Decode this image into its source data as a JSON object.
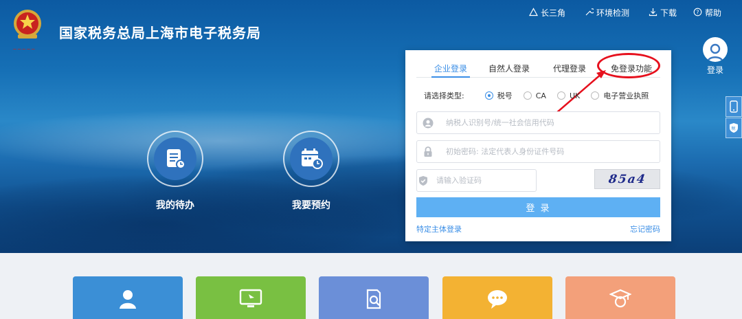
{
  "header": {
    "site_title": "国家税务总局上海市电子税务局",
    "nav": [
      {
        "label": "长三角",
        "icon": "triangle-icon"
      },
      {
        "label": "环境检测",
        "icon": "wrench-icon"
      },
      {
        "label": "下载",
        "icon": "download-icon"
      },
      {
        "label": "帮助",
        "icon": "help-icon"
      }
    ],
    "login_label": "登录"
  },
  "features": [
    {
      "label": "我的待办",
      "icon": "todo-icon"
    },
    {
      "label": "我要预约",
      "icon": "calendar-icon"
    }
  ],
  "login_panel": {
    "tabs": [
      {
        "label": "企业登录",
        "active": true
      },
      {
        "label": "自然人登录",
        "active": false
      },
      {
        "label": "代理登录",
        "active": false
      },
      {
        "label": "免登录功能",
        "active": false,
        "highlighted": true
      }
    ],
    "type_label": "请选择类型:",
    "types": [
      {
        "label": "税号",
        "checked": true
      },
      {
        "label": "CA",
        "checked": false
      },
      {
        "label": "UK",
        "checked": false
      },
      {
        "label": "电子营业执照",
        "checked": false
      }
    ],
    "taxid_placeholder": "纳税人识别号/统一社会信用代码",
    "password_placeholder": "初始密码: 法定代表人身份证件号码",
    "captcha_placeholder": "请输入验证码",
    "captcha_text": "85a4",
    "submit_label": "登 录",
    "special_login_link": "特定主体登录",
    "forgot_password_link": "忘记密码"
  },
  "colors": {
    "accent": "#3a8ee6",
    "submit": "#5eb0f3",
    "annotation": "#e6101d",
    "hero_top": "#0c5aa2"
  },
  "bottom_cards": [
    {
      "color": "#3b8fd6",
      "icon": "user-icon"
    },
    {
      "color": "#79c042",
      "icon": "monitor-icon"
    },
    {
      "color": "#6b8fd8",
      "icon": "search-doc-icon"
    },
    {
      "color": "#f3b233",
      "icon": "chat-icon"
    },
    {
      "color": "#f3a07a",
      "icon": "graduate-icon"
    }
  ]
}
